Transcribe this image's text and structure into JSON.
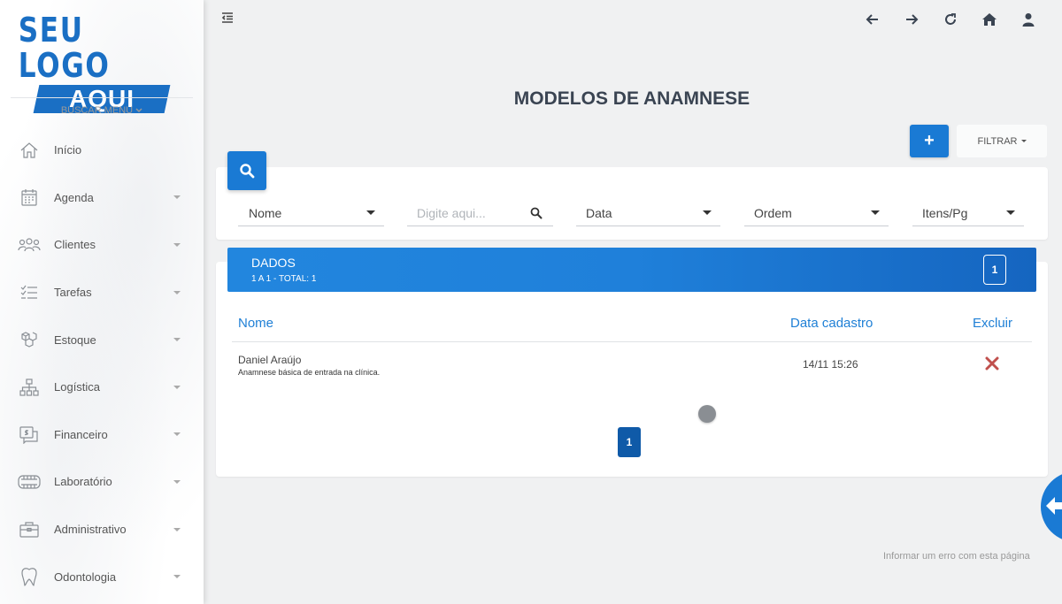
{
  "logo": {
    "line1": "SEU LOGO",
    "line2": "AQUI"
  },
  "sidebar": {
    "search_label": "BUSCAR MENU",
    "items": [
      {
        "label": "Início",
        "icon": "home-icon",
        "has_caret": false
      },
      {
        "label": "Agenda",
        "icon": "calendar-icon",
        "has_caret": true
      },
      {
        "label": "Clientes",
        "icon": "users-icon",
        "has_caret": true
      },
      {
        "label": "Tarefas",
        "icon": "tasks-icon",
        "has_caret": true
      },
      {
        "label": "Estoque",
        "icon": "boxes-icon",
        "has_caret": true
      },
      {
        "label": "Logística",
        "icon": "org-chart-icon",
        "has_caret": true
      },
      {
        "label": "Financeiro",
        "icon": "money-icon",
        "has_caret": true
      },
      {
        "label": "Laboratório",
        "icon": "dentures-icon",
        "has_caret": true
      },
      {
        "label": "Administrativo",
        "icon": "briefcase-icon",
        "has_caret": true
      },
      {
        "label": "Odontologia",
        "icon": "tooth-icon",
        "has_caret": true
      }
    ]
  },
  "header": {
    "title": "MODELOS DE ANAMNESE"
  },
  "toolbar": {
    "add_label": "+",
    "filter_label": "FILTRAR"
  },
  "filters": {
    "field_nome": "Nome",
    "search_placeholder": "Digite aqui...",
    "field_data": "Data",
    "field_ordem": "Ordem",
    "field_itens": "Itens/Pg"
  },
  "data_panel": {
    "title": "DADOS",
    "subtitle": "1 A 1 - TOTAL: 1",
    "page": "1"
  },
  "table": {
    "columns": {
      "nome": "Nome",
      "data": "Data cadastro",
      "excluir": "Excluir"
    },
    "rows": [
      {
        "name": "Daniel Araújo",
        "description": "Anamnese básica de entrada na clínica.",
        "date": "14/11 15:26"
      }
    ]
  },
  "pagination": {
    "current": "1"
  },
  "footer": {
    "report_link": "Informar um erro com esta página"
  },
  "colors": {
    "primary": "#1a7ad4",
    "title": "#3a4452",
    "delete": "#c0504d"
  }
}
